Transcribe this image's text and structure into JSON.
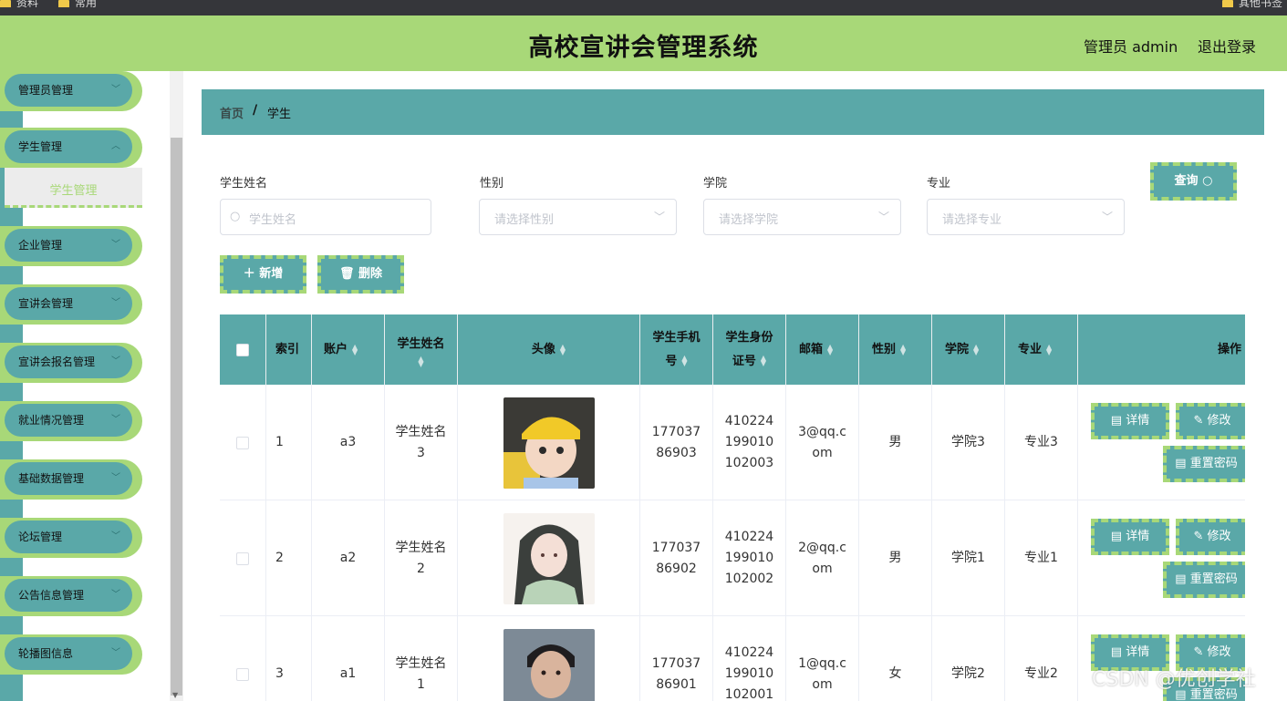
{
  "browser": {
    "bookmarks": [
      "资料",
      "常用",
      "其他书签"
    ]
  },
  "header": {
    "title": "高校宣讲会管理系统",
    "admin": "管理员 admin",
    "logout": "退出登录"
  },
  "sidebar": {
    "items": [
      {
        "label": "管理员管理"
      },
      {
        "label": "学生管理"
      },
      {
        "label": "企业管理"
      },
      {
        "label": "宣讲会管理"
      },
      {
        "label": "宣讲会报名管理"
      },
      {
        "label": "就业情况管理"
      },
      {
        "label": "基础数据管理"
      },
      {
        "label": "论坛管理"
      },
      {
        "label": "公告信息管理"
      },
      {
        "label": "轮播图信息"
      }
    ],
    "active_sub": "学生管理"
  },
  "breadcrumb": {
    "home": "首页",
    "sep": "/",
    "current": "学生"
  },
  "filters": {
    "name_label": "学生姓名",
    "name_placeholder": "学生姓名",
    "gender_label": "性别",
    "gender_placeholder": "请选择性别",
    "college_label": "学院",
    "college_placeholder": "请选择学院",
    "major_label": "专业",
    "major_placeholder": "请选择专业",
    "query_label": "查询"
  },
  "actions": {
    "add_label": "新增",
    "delete_label": "删除"
  },
  "table": {
    "headers": {
      "index": "索引",
      "account": "账户",
      "name": "学生姓名",
      "avatar": "头像",
      "phone": "学生手机号",
      "idcard": "学生身份证号",
      "email": "邮箱",
      "gender": "性别",
      "college": "学院",
      "major": "专业",
      "ops": "操作"
    },
    "rows": [
      {
        "index": "1",
        "account": "a3",
        "name": "学生姓名3",
        "phone": "17703786903",
        "idcard": "410224199010102003",
        "email": "3@qq.com",
        "gender": "男",
        "college": "学院3",
        "major": "专业3"
      },
      {
        "index": "2",
        "account": "a2",
        "name": "学生姓名2",
        "phone": "17703786902",
        "idcard": "410224199010102002",
        "email": "2@qq.com",
        "gender": "男",
        "college": "学院1",
        "major": "专业1"
      },
      {
        "index": "3",
        "account": "a1",
        "name": "学生姓名1",
        "phone": "17703786901",
        "idcard": "410224199010102001",
        "email": "1@qq.com",
        "gender": "女",
        "college": "学院2",
        "major": "专业2"
      }
    ],
    "op_labels": {
      "detail": "详情",
      "edit": "修改",
      "reset": "重置密码"
    }
  },
  "watermark": "CSDN @优创学社"
}
